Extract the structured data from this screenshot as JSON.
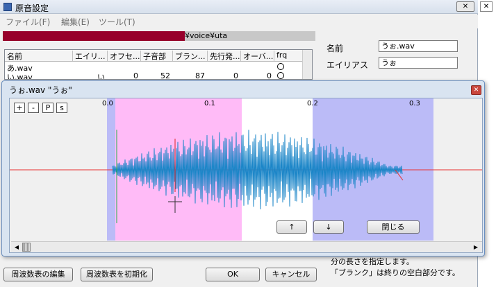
{
  "window": {
    "title": "原音設定"
  },
  "menu": {
    "items": [
      "ファイル(F)",
      "編集(E)",
      "ツール(T)"
    ]
  },
  "path": {
    "suffix": "¥voice¥uta"
  },
  "table": {
    "headers": [
      "名前",
      "エイリ...",
      "オフセ...",
      "子音部",
      "ブラン...",
      "先行発...",
      "オーバ...",
      "frq"
    ],
    "rows": [
      {
        "name": "あ.wav",
        "alias": "",
        "offset": "",
        "consonant": "",
        "blank": "",
        "preutter": "",
        "overlap": ""
      },
      {
        "name": "い.wav",
        "alias": "い",
        "offset": "0",
        "consonant": "52",
        "blank": "87",
        "preutter": "0",
        "overlap": "0"
      }
    ]
  },
  "fields": {
    "name_label": "名前",
    "name_value": "うぉ.wav",
    "alias_label": "エイリアス",
    "alias_value": "うぉ"
  },
  "help": {
    "line1": "分の長さを指定します。",
    "line2": "「ブランク」は終りの空白部分です。"
  },
  "buttons": {
    "edit_freq": "周波数表の編集",
    "init_freq": "周波数表を初期化",
    "ok": "OK",
    "cancel": "キャンセル"
  },
  "dialog": {
    "title": "うぉ.wav \"うぉ\"",
    "toolbar": [
      "+",
      "-",
      "P",
      "s"
    ],
    "ticks": [
      "0.0",
      "0.1",
      "0.2",
      "0.3"
    ],
    "up": "↑",
    "down": "↓",
    "close": "閉じる"
  },
  "colors": {
    "offset_region": "#c8c8c8",
    "consonant_region": "#ffbbf7",
    "fixed_region": "#ffffff",
    "blank_region": "#bbbbf7",
    "wave": "#1c86c8",
    "center_line": "#e83030"
  }
}
